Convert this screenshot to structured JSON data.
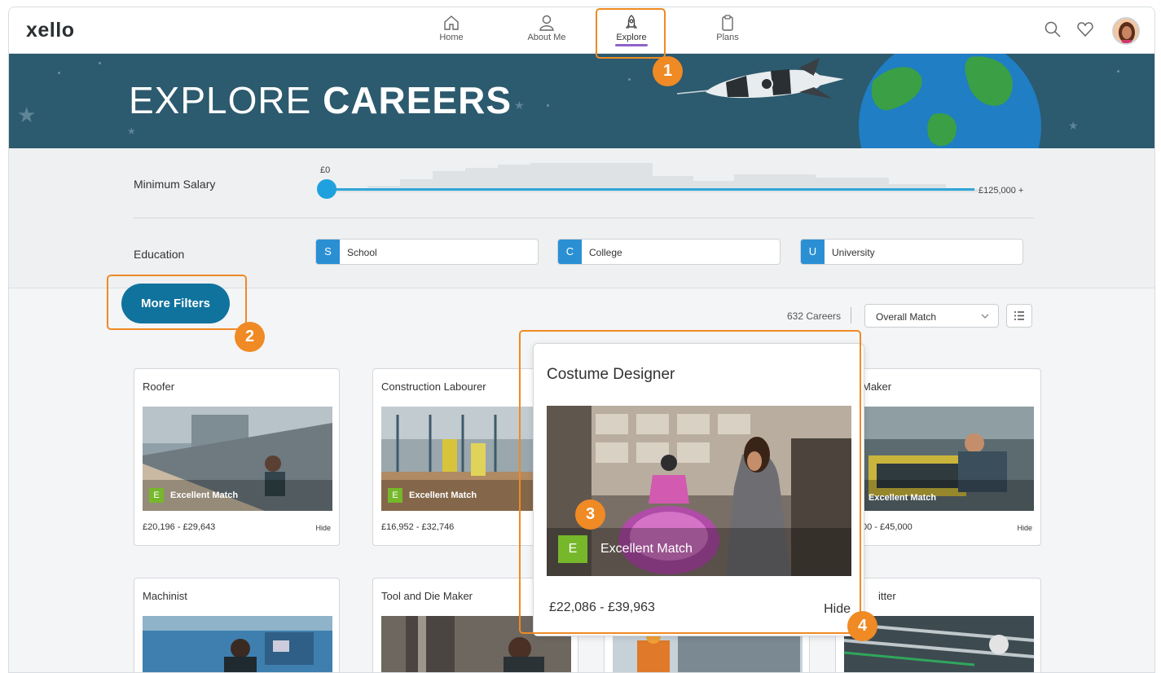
{
  "app": {
    "logo": "xello"
  },
  "nav": {
    "items": [
      {
        "label": "Home",
        "icon": "home-icon"
      },
      {
        "label": "About Me",
        "icon": "user-icon"
      },
      {
        "label": "Explore",
        "icon": "rocket-icon",
        "active": true
      },
      {
        "label": "Plans",
        "icon": "clipboard-icon"
      }
    ],
    "right_icons": [
      "search-icon",
      "heart-icon",
      "avatar"
    ]
  },
  "banner": {
    "title_light": "EXPLORE ",
    "title_bold": "CAREERS"
  },
  "filters": {
    "salary_label": "Minimum Salary",
    "salary_min": "£0",
    "salary_max": "£125,000 +",
    "salary_value_fraction": 0,
    "education_label": "Education",
    "education": [
      {
        "letter": "S",
        "label": "School"
      },
      {
        "letter": "C",
        "label": "College"
      },
      {
        "letter": "U",
        "label": "University"
      }
    ]
  },
  "controls": {
    "more_filters": "More Filters",
    "count": "632 Careers",
    "sort": "Overall Match"
  },
  "cards": [
    {
      "title": "Roofer",
      "match_letter": "E",
      "match": "Excellent Match",
      "salary": "£20,196 - £29,643",
      "hide": "Hide"
    },
    {
      "title": "Construction Labourer",
      "match_letter": "E",
      "match": "Excellent Match",
      "salary": "£16,952 - £32,746",
      "hide": "Hide"
    },
    {
      "title": "Maker",
      "match_letter": "E",
      "match": "Excellent Match",
      "salary": "00 - £45,000",
      "hide": "Hide"
    },
    {
      "title": "Machinist"
    },
    {
      "title": "Tool and Die Maker"
    },
    {
      "title": "itter"
    }
  ],
  "popup": {
    "title": "Costume Designer",
    "match_letter": "E",
    "match": "Excellent Match",
    "salary": "£22,086 - £39,963",
    "hide": "Hide"
  },
  "callouts": [
    "1",
    "2",
    "3",
    "4"
  ],
  "colors": {
    "accent": "#ef8a24",
    "banner": "#2c5a6e",
    "primary_button": "#10739e",
    "match_green": "#76b82a",
    "slider": "#1ea1de",
    "nav_active": "#8e63c9"
  }
}
